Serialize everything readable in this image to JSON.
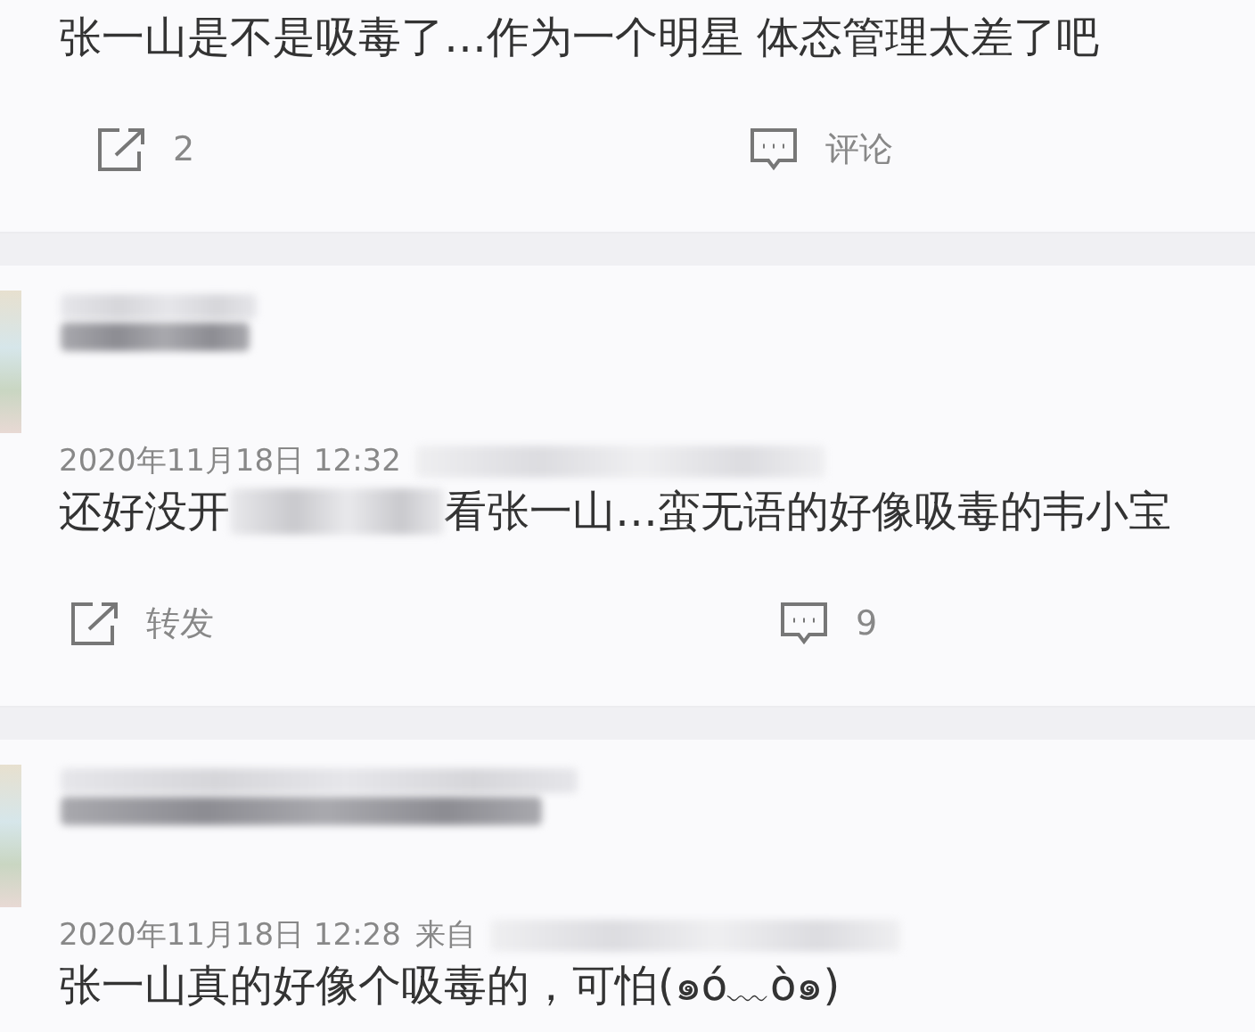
{
  "posts": [
    {
      "kind": "tail",
      "text": "张一山是不是吸毒了…作为一个明星 体态管理太差了吧",
      "actions": {
        "share": "2",
        "comment": "评论"
      }
    },
    {
      "kind": "comment",
      "date": "2020年11月18日 12:32",
      "source_redacted": true,
      "text_before": "还好没开",
      "text_after": "看张一山…蛮无语的好像吸毒的韦小宝",
      "actions": {
        "share": "转发",
        "comment": "9"
      }
    },
    {
      "kind": "comment",
      "date": "2020年11月18日 12:28",
      "from": "来自",
      "source_redacted": true,
      "text_after": "张一山真的好像个吸毒的，可怕(๑ó﹏ò๑)"
    }
  ]
}
